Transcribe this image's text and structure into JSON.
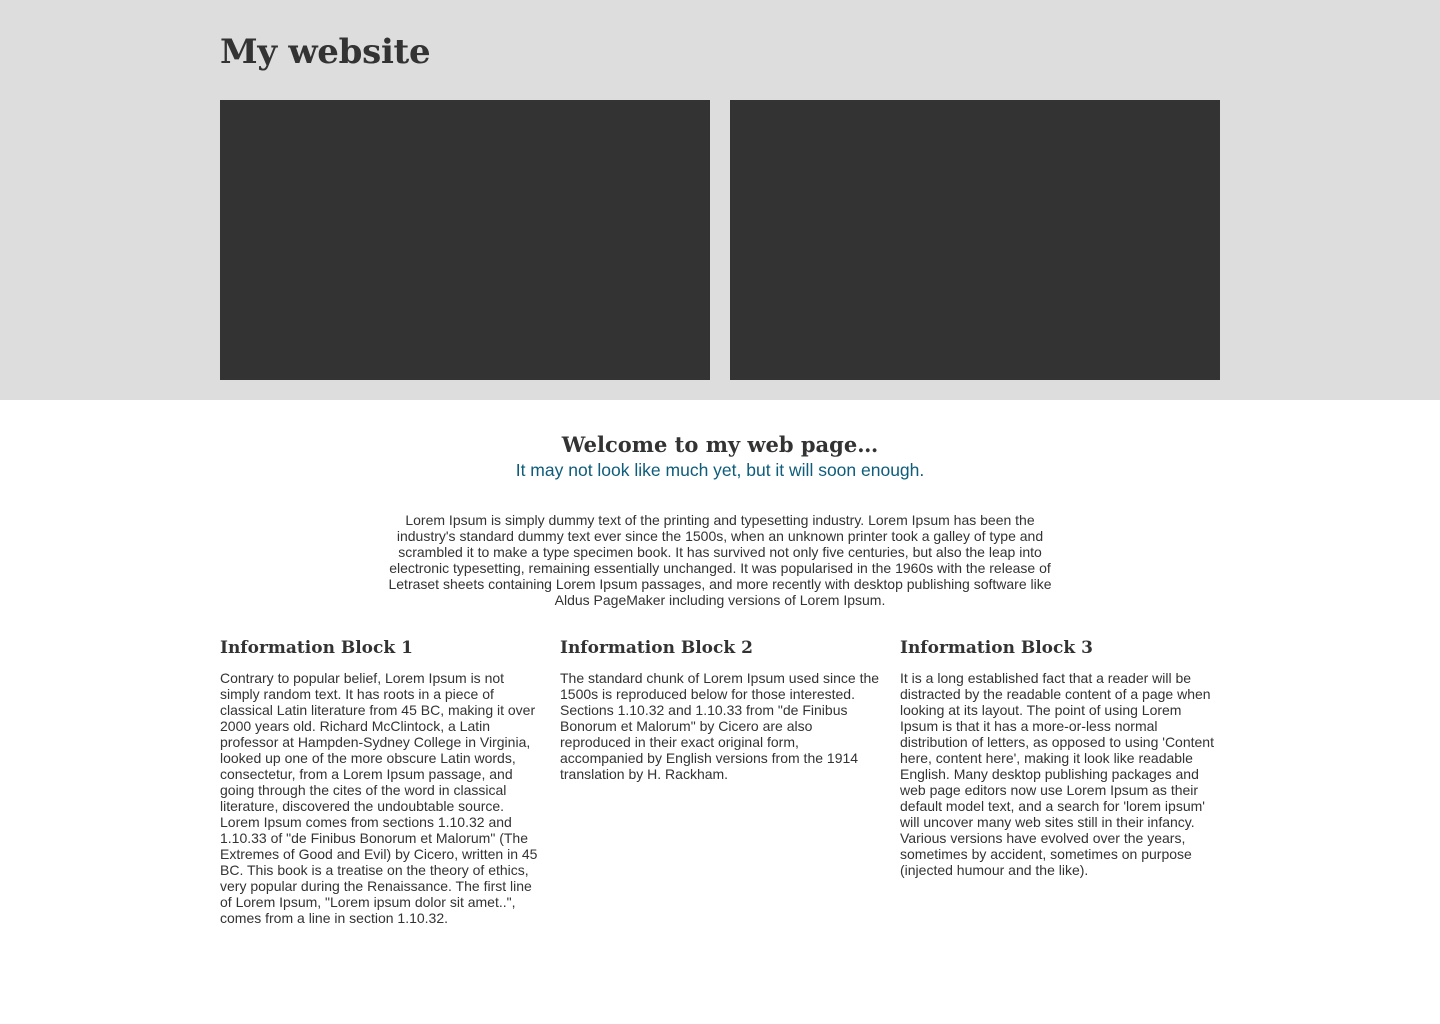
{
  "header": {
    "site_title": "My website"
  },
  "welcome": {
    "title": "Welcome to my web page…",
    "subtitle": "It may not look like much yet, but it will soon enough.",
    "intro": "Lorem Ipsum is simply dummy text of the printing and typesetting industry. Lorem Ipsum has been the industry's standard dummy text ever since the 1500s, when an unknown printer took a galley of type and scrambled it to make a type specimen book. It has survived not only five centuries, but also the leap into electronic typesetting, remaining essentially unchanged. It was popularised in the 1960s with the release of Letraset sheets containing Lorem Ipsum passages, and more recently with desktop publishing software like Aldus PageMaker including versions of Lorem Ipsum."
  },
  "blocks": [
    {
      "title": "Information Block 1",
      "body": "Contrary to popular belief, Lorem Ipsum is not simply random text. It has roots in a piece of classical Latin literature from 45 BC, making it over 2000 years old. Richard McClintock, a Latin professor at Hampden-Sydney College in Virginia, looked up one of the more obscure Latin words, consectetur, from a Lorem Ipsum passage, and going through the cites of the word in classical literature, discovered the undoubtable source. Lorem Ipsum comes from sections 1.10.32 and 1.10.33 of \"de Finibus Bonorum et Malorum\" (The Extremes of Good and Evil) by Cicero, written in 45 BC. This book is a treatise on the theory of ethics, very popular during the Renaissance. The first line of Lorem Ipsum, \"Lorem ipsum dolor sit amet..\", comes from a line in section 1.10.32."
    },
    {
      "title": "Information Block 2",
      "body": "The standard chunk of Lorem Ipsum used since the 1500s is reproduced below for those interested. Sections 1.10.32 and 1.10.33 from \"de Finibus Bonorum et Malorum\" by Cicero are also reproduced in their exact original form, accompanied by English versions from the 1914 translation by H. Rackham."
    },
    {
      "title": "Information Block 3",
      "body": "It is a long established fact that a reader will be distracted by the readable content of a page when looking at its layout. The point of using Lorem Ipsum is that it has a more-or-less normal distribution of letters, as opposed to using 'Content here, content here', making it look like readable English. Many desktop publishing packages and web page editors now use Lorem Ipsum as their default model text, and a search for 'lorem ipsum' will uncover many web sites still in their infancy. Various versions have evolved over the years, sometimes by accident, sometimes on purpose (injected humour and the like)."
    }
  ],
  "colors": {
    "hero_background": "#dddddd",
    "panel": "#333333",
    "text": "#333333",
    "accent": "#0e5c7a"
  }
}
